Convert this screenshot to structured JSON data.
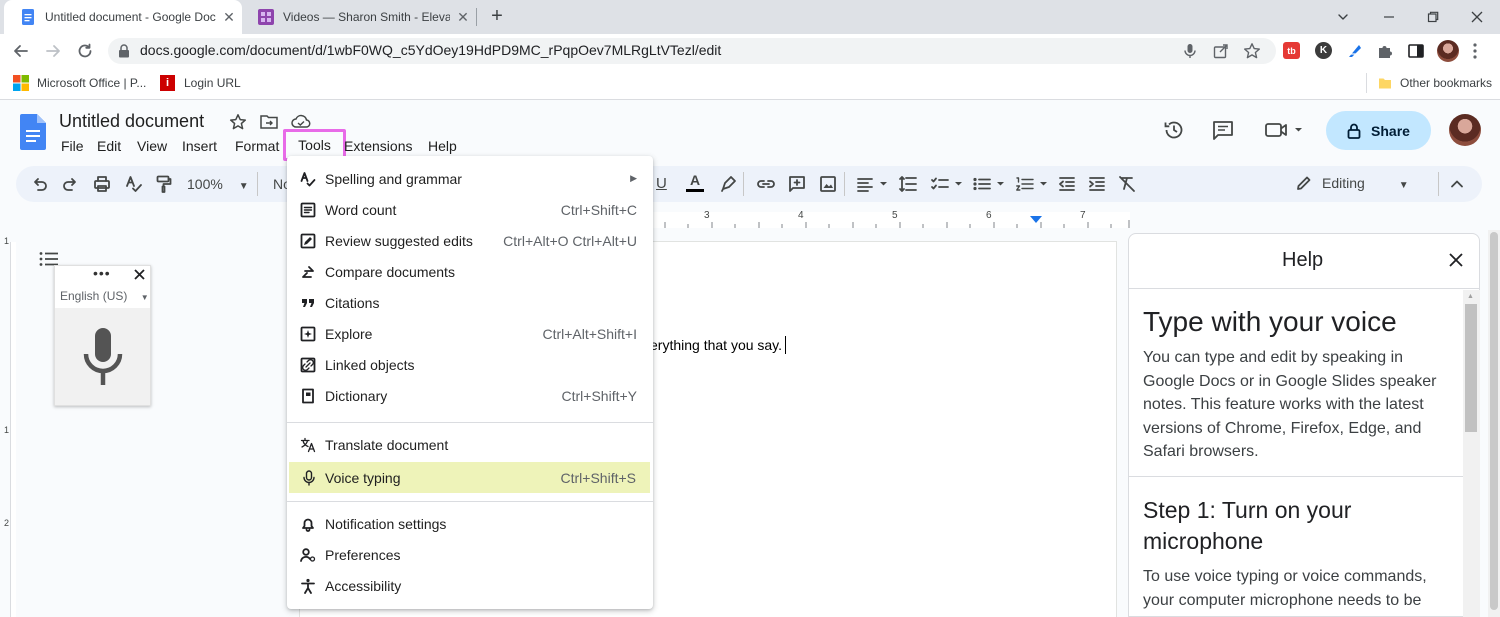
{
  "browser": {
    "tabs": [
      {
        "title": "Untitled document - Google Docs",
        "active": true
      },
      {
        "title": "Videos — Sharon Smith - Elevating",
        "active": false
      }
    ],
    "url": "docs.google.com/document/d/1wbF0WQ_c5YdOey19HdPD9MC_rPqpOev7MLRgLtVTezl/edit",
    "bookmarks": [
      "Microsoft Office | P...",
      "Login URL"
    ],
    "other_bookmarks": "Other bookmarks"
  },
  "docs": {
    "title": "Untitled document",
    "menus": [
      "File",
      "Edit",
      "View",
      "Insert",
      "Format",
      "Tools",
      "Extensions",
      "Help"
    ],
    "share_label": "Share",
    "zoom": "100%",
    "style_partial": "No",
    "mode": "Editing",
    "body_text": "erything that you say.",
    "ruler_numbers": [
      "3",
      "4",
      "5",
      "6",
      "7"
    ],
    "vruler_numbers": [
      "1",
      "1",
      "2"
    ]
  },
  "voice_widget": {
    "language": "English (US)"
  },
  "tools_menu": {
    "items": [
      {
        "label": "Spelling and grammar",
        "shortcut": "",
        "icon": "spellcheck-icon",
        "submenu": true
      },
      {
        "label": "Word count",
        "shortcut": "Ctrl+Shift+C",
        "icon": "word-count-icon"
      },
      {
        "label": "Review suggested edits",
        "shortcut": "Ctrl+Alt+O Ctrl+Alt+U",
        "icon": "review-edits-icon"
      },
      {
        "label": "Compare documents",
        "shortcut": "",
        "icon": "compare-icon"
      },
      {
        "label": "Citations",
        "shortcut": "",
        "icon": "quote-icon"
      },
      {
        "label": "Explore",
        "shortcut": "Ctrl+Alt+Shift+I",
        "icon": "explore-icon"
      },
      {
        "label": "Linked objects",
        "shortcut": "",
        "icon": "linked-objects-icon"
      },
      {
        "label": "Dictionary",
        "shortcut": "Ctrl+Shift+Y",
        "icon": "dictionary-icon"
      },
      {
        "label": "Translate document",
        "shortcut": "",
        "icon": "translate-icon"
      },
      {
        "label": "Voice typing",
        "shortcut": "Ctrl+Shift+S",
        "icon": "mic-icon",
        "highlighted": true
      },
      {
        "label": "Notification settings",
        "shortcut": "",
        "icon": "bell-icon"
      },
      {
        "label": "Preferences",
        "shortcut": "",
        "icon": "preferences-icon"
      },
      {
        "label": "Accessibility",
        "shortcut": "",
        "icon": "accessibility-icon"
      }
    ]
  },
  "help_panel": {
    "title": "Help",
    "heading": "Type with your voice",
    "intro": "You can type and edit by speaking in Google Docs or in Google Slides speaker notes. This feature works with the latest versions of Chrome, Firefox, Edge, and Safari browsers.",
    "step1_heading": "Step 1: Turn on your microphone",
    "step1_text": "To use voice typing or voice commands, your computer microphone needs to be"
  },
  "colors": {
    "tab_strip": "#dee1e6",
    "share_button": "#c2e7ff",
    "toolbar": "#edf2fa",
    "tools_highlight_border": "#e86be8",
    "voice_typing_highlight": "#eef3b9",
    "docs_blue": "#4285f4"
  }
}
